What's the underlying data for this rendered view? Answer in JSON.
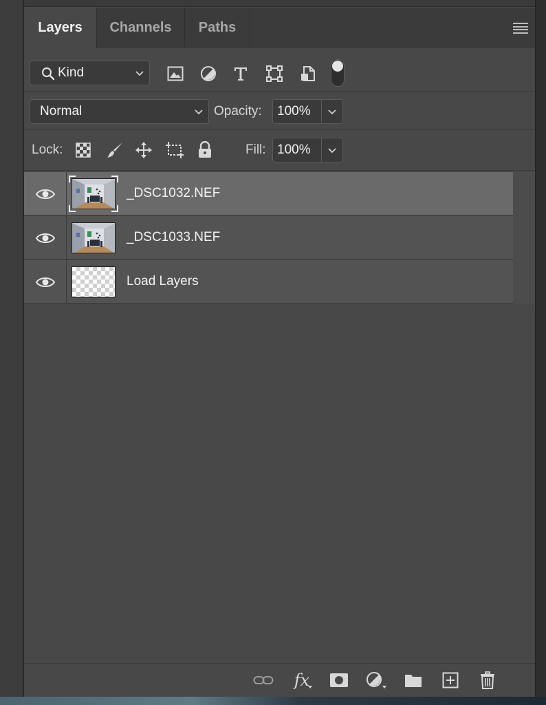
{
  "tabs": [
    {
      "label": "Layers",
      "active": true
    },
    {
      "label": "Channels",
      "active": false
    },
    {
      "label": "Paths",
      "active": false
    }
  ],
  "filter": {
    "kind_label": "Kind",
    "icons": [
      "pixel-layer-filter-icon",
      "adjustment-layer-filter-icon",
      "type-layer-filter-icon",
      "shape-layer-filter-icon",
      "smart-object-filter-icon"
    ],
    "toggle_on": true
  },
  "blend": {
    "mode": "Normal",
    "opacity_label": "Opacity:",
    "opacity_value": "100%"
  },
  "lock": {
    "label": "Lock:",
    "icons": [
      "lock-transparent-pixels-icon",
      "lock-image-pixels-icon",
      "lock-position-icon",
      "lock-artboard-icon",
      "lock-all-icon"
    ],
    "fill_label": "Fill:",
    "fill_value": "100%"
  },
  "layers": [
    {
      "name": "_DSC1032.NEF",
      "visible": true,
      "selected": true,
      "thumb": "photo"
    },
    {
      "name": "_DSC1033.NEF",
      "visible": true,
      "selected": false,
      "thumb": "photo"
    },
    {
      "name": "Load Layers",
      "visible": true,
      "selected": false,
      "thumb": "transparent"
    }
  ],
  "footer_icons": [
    "link-layers-icon",
    "layer-style-fx-icon",
    "add-mask-icon",
    "new-adjustment-layer-icon",
    "new-group-icon",
    "new-layer-icon",
    "delete-layer-icon"
  ],
  "footer_fx_label": "fx",
  "colors": {
    "panel_bg": "#484848",
    "selected_layer": "#6a6a6a",
    "layer_bg": "#535353"
  }
}
